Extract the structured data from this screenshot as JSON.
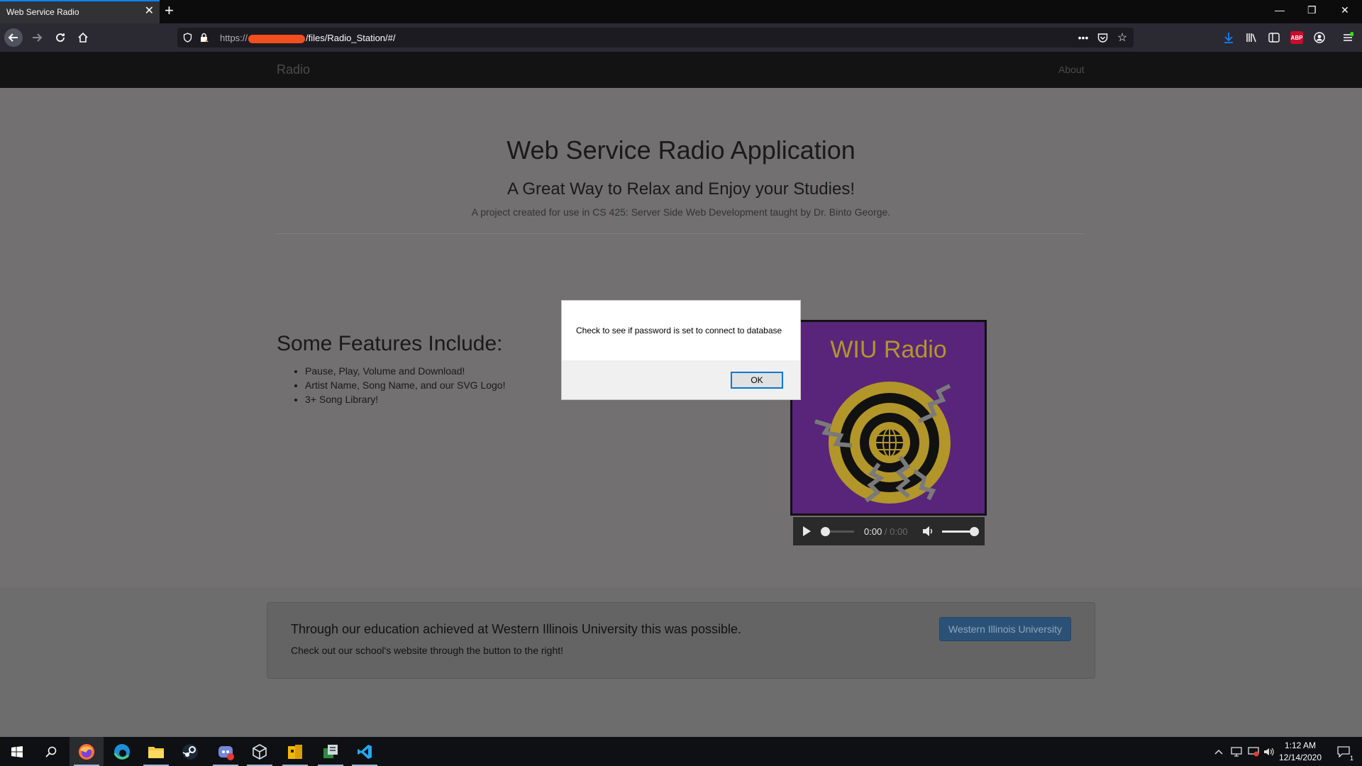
{
  "browser": {
    "tab_title": "Web Service Radio",
    "url_prefix": "https://",
    "url_suffix": "/files/Radio_Station/#/"
  },
  "site": {
    "brand": "Radio",
    "nav_about": "About",
    "hero_title": "Web Service Radio Application",
    "hero_subtitle": "A Great Way to Relax and Enjoy your Studies!",
    "hero_description": "A project created for use in CS 425: Server Side Web Development taught by Dr. Binto George.",
    "features_title": "Some Features Include:",
    "features": [
      "Pause, Play, Volume and Download!",
      "Artist Name, Song Name, and our SVG Logo!",
      "3+ Song Library!"
    ],
    "logo_text": "WIU Radio",
    "player": {
      "current_time": "0:00",
      "separator": " / ",
      "duration": "0:00",
      "progress": 0,
      "volume": 1.0
    },
    "footer": {
      "title": "Through our education achieved at Western Illinois University this was possible.",
      "text": "Check out our school's website through the button to the right!",
      "button": "Western Illinois University"
    }
  },
  "alert": {
    "message": "Check to see if password is set to connect to database",
    "ok_label": "OK"
  },
  "taskbar": {
    "time": "1:12 AM",
    "date": "12/14/2020",
    "notification_count": "1"
  },
  "colors": {
    "accent": "#0a84ff",
    "logo_purple": "#58257a",
    "logo_gold": "#b2962a",
    "wiu_button": "#2b5276"
  }
}
